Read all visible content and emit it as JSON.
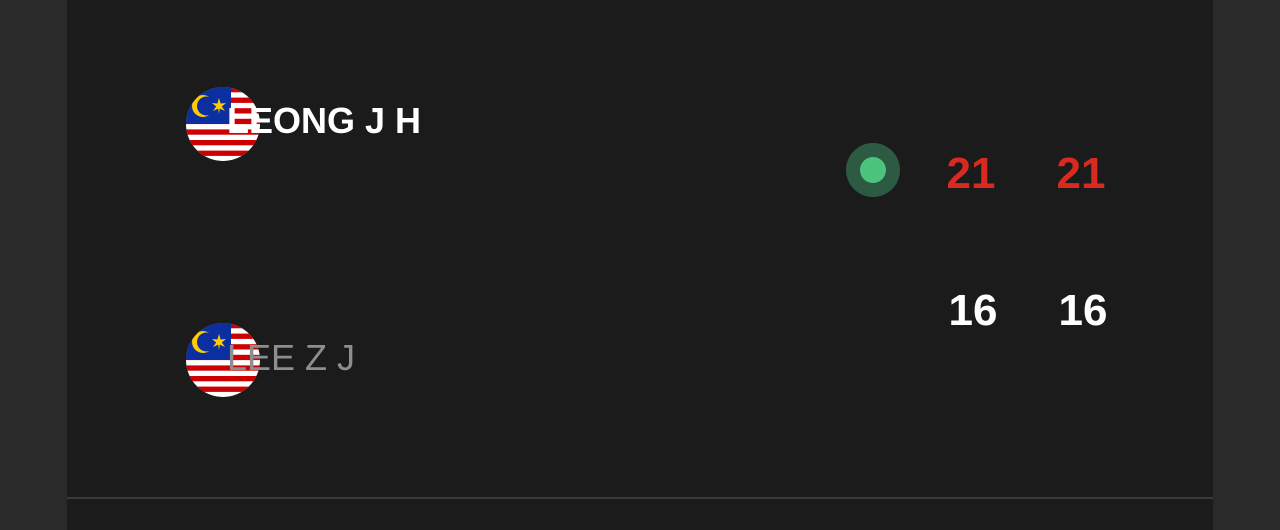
{
  "colors": {
    "background": "#1c1b1b",
    "winner_score": "#d92a1f",
    "loser_score": "#ffffff",
    "serve_indicator": "#4cc47e"
  },
  "match": {
    "players": [
      {
        "name": "LEONG J H",
        "flag_icon": "malaysia-flag-icon",
        "serving": true,
        "games": [
          "21",
          "21"
        ]
      },
      {
        "name": "LEE Z J",
        "flag_icon": "malaysia-flag-icon",
        "serving": false,
        "games": [
          "16",
          "16"
        ]
      }
    ]
  }
}
